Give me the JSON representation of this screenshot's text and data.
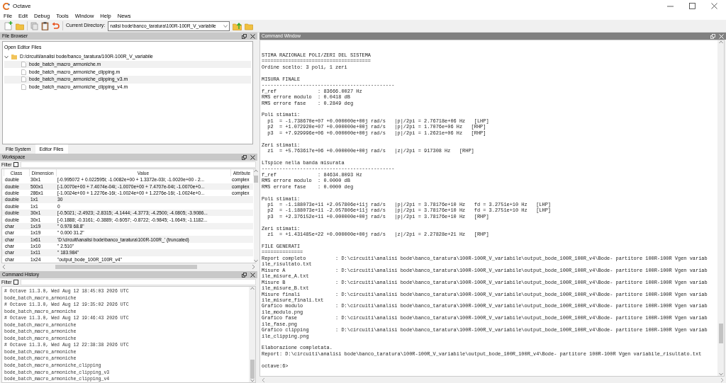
{
  "window": {
    "title": "Octave"
  },
  "menu": [
    "File",
    "Edit",
    "Debug",
    "Tools",
    "Window",
    "Help",
    "News"
  ],
  "toolbar": {
    "directory_label": "Current Directory:",
    "directory": "nalisi bode\\banco_taratura\\100R-100R_V_variabile"
  },
  "file_browser": {
    "title": "File Browser",
    "heading": "Open Editor Files",
    "tree": [
      {
        "label": "D:/circuiti/analisi bode/banco_taratura/100R-100R_V_variabile",
        "expanded": true,
        "children": [
          {
            "label": "bode_batch_macro_armoniche.m"
          },
          {
            "label": "bode_batch_macro_armoniche_clipping.m"
          },
          {
            "label": "bode_batch_macro_armoniche_clipping_v3.m"
          },
          {
            "label": "bode_batch_macro_armoniche_clipping_v4.m"
          }
        ]
      }
    ],
    "tabs": [
      {
        "label": "File System",
        "selected": false
      },
      {
        "label": "Editor Files",
        "selected": true
      }
    ]
  },
  "workspace": {
    "title": "Workspace",
    "filter": {
      "label": "Filter",
      "checked": false
    },
    "columns": [
      "Class",
      "Dimension",
      "Value",
      "Attribute"
    ],
    "rows": [
      [
        "double",
        "30x1",
        "[-0.995072 + 0.022595i; -1.0082e+00 + 1.3372e-03i; -1.0020e+00 - 2...",
        "complex"
      ],
      [
        "double",
        "500x1",
        "[-1.0070e+00 + 7.4074e-04i; -1.0070e+00 + 7.4707e-04i; -1.0070e+0...",
        "complex"
      ],
      [
        "double",
        "286x1",
        "[-1.0024e+00 + 1.2276e-16i; -1.0024e+00 + 1.2276e-16i; -1.0024e+0...",
        "complex"
      ],
      [
        "double",
        "1x1",
        "30",
        ""
      ],
      [
        "double",
        "1x1",
        "0",
        ""
      ],
      [
        "double",
        "30x1",
        "[-0.5021; -2.4923; -2.8315; -4.1444; -4.3773; -4.2500; -4.0805; -3.9086...",
        ""
      ],
      [
        "double",
        "30x1",
        "[-0.1888; -0.3161; -0.3889; -0.6057; -0.8722; -0.9845; -1.0649; -1.1182...",
        ""
      ],
      [
        "char",
        "1x19",
        "\"    0.978    68.8\"",
        ""
      ],
      [
        "char",
        "1x19",
        "\"    0.000    31.2\"",
        ""
      ],
      [
        "char",
        "1x61",
        "'D:\\circuiti\\analisi bode\\banco_taratura\\100R-100R_' (truncated)",
        ""
      ],
      [
        "char",
        "1x10",
        "\"    2.510\"",
        ""
      ],
      [
        "char",
        "1x11",
        "\"   183.984\"",
        ""
      ],
      [
        "char",
        "1x24",
        "\"output_bode_100R_100R_v4\"",
        ""
      ]
    ]
  },
  "command_history": {
    "title": "Command History",
    "filter": {
      "label": "Filter",
      "checked": false
    },
    "entries": [
      "# Octave 11.3.0, Wed Aug 12 18:45:03 2026 UTC",
      "bode_batch_macro_armoniche",
      "# Octave 11.3.0, Wed Aug 12 19:35:02 2026 UTC",
      "bode_batch_macro_armoniche",
      "# Octave 11.3.0, Wed Aug 12 19:46:43 2026 UTC",
      "bode_batch_macro_armoniche",
      "bode_batch_macro_armoniche",
      "bode_batch_macro_armoniche",
      "# Octave 11.3.0, Wed Aug 12 22:38:38 2026 UTC",
      "bode_batch_macro_armoniche",
      "bode_batch_macro_armoniche",
      "bode_batch_macro_armoniche_clipping",
      "bode_batch_macro_armoniche_clipping_v3",
      "bode_batch_macro_armoniche_clipping_v4"
    ]
  },
  "command_window": {
    "title": "Command Window",
    "blocks": [
      {
        "kind": "plain",
        "lines": [
          "STIMA RAZIONALE POLI/ZERI DEL SISTEMA",
          "=====================================",
          "Ordine scelto: 3 poli, 1 zeri"
        ]
      },
      {
        "kind": "plain",
        "lines": [
          "MISURA FINALE",
          "---------------------------------------------",
          "f_ref              : 83666.0027 Hz",
          "RMS errore modulo  : 0.0418 dB",
          "RMS errore fase    : 0.2849 deg"
        ]
      },
      {
        "kind": "plain",
        "lines": [
          "Poli stimati:",
          "  p1  = -1.738670e+07 +0.000000e+00j rad/s   |p|/2pi = 2.76718e+06 Hz   [LHP]",
          "  p2  = +1.072920e+07 +0.000000e+00j rad/s   |p|/2pi = 1.7076e+06 Hz   [RHP]",
          "  p3  = +7.929996e+06 +0.000000e+00j rad/s   |p|/2pi = 1.2621e+06 Hz   [RHP]"
        ]
      },
      {
        "kind": "plain",
        "lines": [
          "Zeri stimati:",
          "  z1  = +5.763617e+06 +0.000000e+00j rad/s   |z|/2pi = 917308 Hz   [RHP]"
        ]
      },
      {
        "kind": "plain",
        "lines": [
          "LTspice nella banda misurata",
          "---------------------------------------------",
          "f_ref              : 84634.8093 Hz",
          "RMS errore modulo  : 0.0000 dB",
          "RMS errore fase    : 0.0000 deg"
        ]
      },
      {
        "kind": "plain",
        "lines": [
          "Poli stimati:",
          "  p1  = -1.188073e+11 +2.057806e+11j rad/s   |p|/2pi = 3.78176e+10 Hz   fd = 3.2751e+10 Hz   [LHP]",
          "  p2  = -1.188073e+11 -2.057806e+11j rad/s   |p|/2pi = 3.78176e+10 Hz   fd = 3.2751e+10 Hz   [LHP]",
          "  p3  = +2.376152e+11 +0.000000e+00j rad/s   |p|/2pi = 3.78176e+10 Hz   [RHP]"
        ]
      },
      {
        "kind": "plain",
        "lines": [
          "Zeri stimati:",
          "  z1  = +1.431485e+22 +0.000000e+00j rad/s   |z|/2pi = 2.27828e+21 Hz   [RHP]"
        ]
      },
      {
        "kind": "section",
        "lines": [
          "FILE GENERATI",
          "==============",
          "Report completo          : D:\\circuiti\\analisi bode\\banco_taratura\\100R-100R_V_variabile\\output_bode_100R_100R_v4\\Bode- partitore 100R-100R Vgen variab",
          "ile_risultato.txt",
          "Misure A                 : D:\\circuiti\\analisi bode\\banco_taratura\\100R-100R_V_variabile\\output_bode_100R_100R_v4\\Bode- partitore 100R-100R Vgen variab",
          "ile_misure_A.txt",
          "Misure B                 : D:\\circuiti\\analisi bode\\banco_taratura\\100R-100R_V_variabile\\output_bode_100R_100R_v4\\Bode- partitore 100R-100R Vgen variab",
          "ile_misure_B.txt",
          "Misure finali            : D:\\circuiti\\analisi bode\\banco_taratura\\100R-100R_V_variabile\\output_bode_100R_100R_v4\\Bode- partitore 100R-100R Vgen variab",
          "ile_misure_finali.txt",
          "Grafico modulo           : D:\\circuiti\\analisi bode\\banco_taratura\\100R-100R_V_variabile\\output_bode_100R_100R_v4\\Bode- partitore 100R-100R Vgen variab",
          "ile_modulo.png",
          "Grafico fase             : D:\\circuiti\\analisi bode\\banco_taratura\\100R-100R_V_variabile\\output_bode_100R_100R_v4\\Bode- partitore 100R-100R Vgen variab",
          "ile_fase.png",
          "Grafico clipping         : D:\\circuiti\\analisi bode\\banco_taratura\\100R-100R_V_variabile\\output_bode_100R_100R_v4\\Bode- partitore 100R-100R Vgen variab",
          "ile_clipping.png"
        ]
      },
      {
        "kind": "plain",
        "lines": [
          "Elaborazione completata.",
          "Report: D:\\circuiti\\analisi bode\\banco_taratura\\100R-100R_V_variabile\\output_bode_100R_100R_v4\\Bode- partitore 100R-100R Vgen variabile_risultato.txt"
        ]
      },
      {
        "kind": "prompt",
        "lines": [
          "octave:6>"
        ]
      }
    ]
  }
}
